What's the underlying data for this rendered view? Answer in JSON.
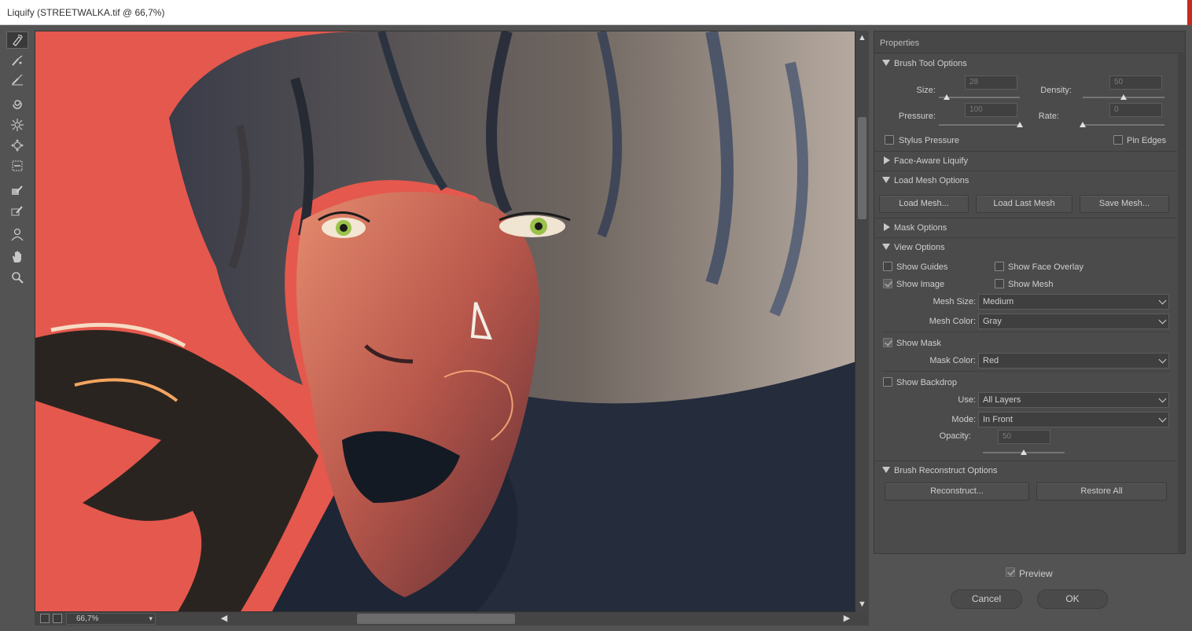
{
  "window": {
    "title": "Liquify (STREETWALKA.tif @ 66,7%)"
  },
  "toolbar": {
    "tools": [
      {
        "name": "forward-warp-tool",
        "icon": "warp-brush-icon",
        "active": true
      },
      {
        "name": "reconstruct-tool",
        "icon": "reconstruct-brush-icon"
      },
      {
        "name": "smooth-tool",
        "icon": "smooth-brush-icon"
      },
      {
        "name": "twirl-clockwise-tool",
        "icon": "twirl-icon"
      },
      {
        "name": "pucker-tool",
        "icon": "pucker-icon"
      },
      {
        "name": "bloat-tool",
        "icon": "bloat-icon"
      },
      {
        "name": "push-left-tool",
        "icon": "push-left-icon"
      },
      {
        "name": "freeze-mask-tool",
        "icon": "freeze-mask-icon"
      },
      {
        "name": "thaw-mask-tool",
        "icon": "thaw-mask-icon"
      },
      {
        "name": "face-tool",
        "icon": "face-person-icon"
      },
      {
        "name": "hand-tool",
        "icon": "hand-icon"
      },
      {
        "name": "zoom-tool",
        "icon": "zoom-magnifier-icon"
      }
    ]
  },
  "statusbar": {
    "zoom": "66,7%"
  },
  "properties": {
    "header": "Properties",
    "brush_tool_options": {
      "title": "Brush Tool Options",
      "size_label": "Size:",
      "size_value": "28",
      "size_level": 0.1,
      "density_label": "Density:",
      "density_value": "50",
      "density_level": 0.5,
      "pressure_label": "Pressure:",
      "pressure_value": "100",
      "pressure_level": 1.0,
      "rate_label": "Rate:",
      "rate_value": "0",
      "rate_level": 0.0,
      "stylus_pressure": "Stylus Pressure",
      "pin_edges": "Pin Edges"
    },
    "face_aware": {
      "title": "Face-Aware Liquify"
    },
    "load_mesh": {
      "title": "Load Mesh Options",
      "load_mesh": "Load Mesh...",
      "load_last_mesh": "Load Last Mesh",
      "save_mesh": "Save Mesh..."
    },
    "mask_options": {
      "title": "Mask Options"
    },
    "view_options": {
      "title": "View Options",
      "show_guides": "Show Guides",
      "show_face_overlay": "Show Face Overlay",
      "show_image": "Show Image",
      "show_mesh": "Show Mesh",
      "mesh_size_label": "Mesh Size:",
      "mesh_size_value": "Medium",
      "mesh_color_label": "Mesh Color:",
      "mesh_color_value": "Gray",
      "show_mask": "Show Mask",
      "mask_color_label": "Mask Color:",
      "mask_color_value": "Red",
      "show_backdrop": "Show Backdrop",
      "use_label": "Use:",
      "use_value": "All Layers",
      "mode_label": "Mode:",
      "mode_value": "In Front",
      "opacity_label": "Opacity:",
      "opacity_value": "50",
      "opacity_level": 0.5
    },
    "brush_reconstruct": {
      "title": "Brush Reconstruct Options",
      "reconstruct": "Reconstruct...",
      "restore_all": "Restore All"
    }
  },
  "footer": {
    "preview": "Preview",
    "cancel": "Cancel",
    "ok": "OK"
  },
  "colors": {
    "accent_bg": "#ef5a50",
    "panel": "#4b4b4b",
    "frame": "#535353"
  }
}
